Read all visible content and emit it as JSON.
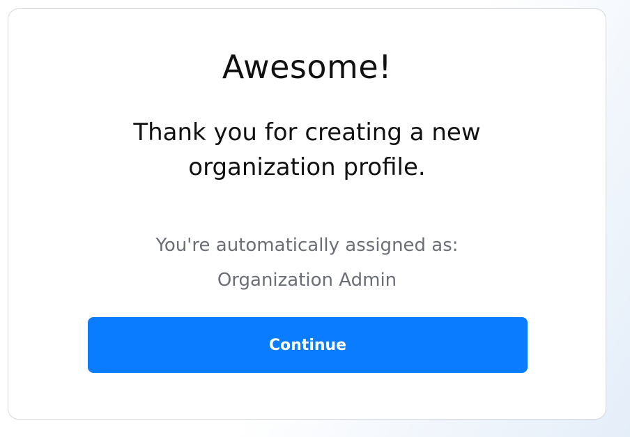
{
  "card": {
    "title": "Awesome!",
    "message_line1": "Thank you for creating a new",
    "message_line2": "organization profile.",
    "assigned_line1": "You're automatically assigned as:",
    "assigned_line2": "Organization Admin",
    "continue_label": "Continue"
  },
  "colors": {
    "accent": "#0a7cff",
    "muted_text": "#6b6f75",
    "card_border": "#d6d9de"
  }
}
